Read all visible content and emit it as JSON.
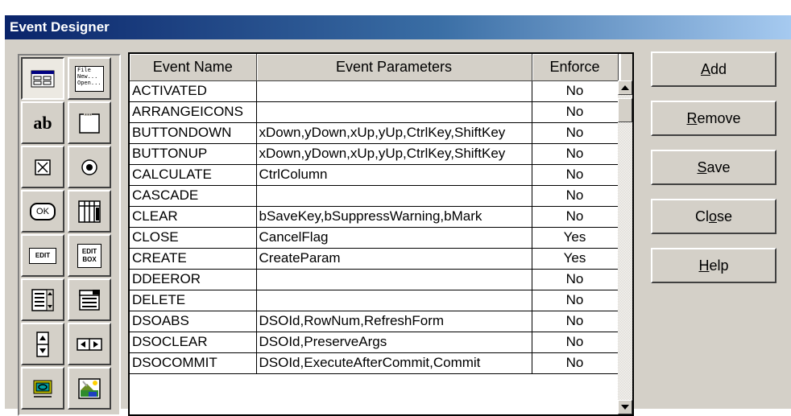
{
  "window": {
    "title": "Event Designer"
  },
  "palette": {
    "tools": [
      {
        "icon": "form-tool-icon",
        "label": ""
      },
      {
        "icon": "menu-tool-icon",
        "label": "File New... Open..."
      },
      {
        "icon": "label-tool-icon",
        "label": "ab"
      },
      {
        "icon": "frame-tool-icon",
        "label": ""
      },
      {
        "icon": "checkbox-tool-icon",
        "label": ""
      },
      {
        "icon": "radio-button-tool-icon",
        "label": ""
      },
      {
        "icon": "command-button-tool-icon",
        "label": "OK"
      },
      {
        "icon": "grid-tool-icon",
        "label": ""
      },
      {
        "icon": "edit-tool-icon",
        "label": "EDIT"
      },
      {
        "icon": "edit-box-tool-icon",
        "label": "EDIT BOX"
      },
      {
        "icon": "list-box-tool-icon",
        "label": ""
      },
      {
        "icon": "combo-box-tool-icon",
        "label": ""
      },
      {
        "icon": "vertical-spin-tool-icon",
        "label": ""
      },
      {
        "icon": "horizontal-spin-tool-icon",
        "label": ""
      },
      {
        "icon": "ole-control-tool-icon",
        "label": ""
      },
      {
        "icon": "image-tool-icon",
        "label": ""
      }
    ]
  },
  "grid": {
    "columns": [
      "Event Name",
      "Event Parameters",
      "Enforce"
    ],
    "rows": [
      [
        "ACTIVATED",
        "",
        "No"
      ],
      [
        "ARRANGEICONS",
        "",
        "No"
      ],
      [
        "BUTTONDOWN",
        "xDown,yDown,xUp,yUp,CtrlKey,ShiftKey",
        "No"
      ],
      [
        "BUTTONUP",
        "xDown,yDown,xUp,yUp,CtrlKey,ShiftKey",
        "No"
      ],
      [
        "CALCULATE",
        "CtrlColumn",
        "No"
      ],
      [
        "CASCADE",
        "",
        "No"
      ],
      [
        "CLEAR",
        "bSaveKey,bSuppressWarning,bMark",
        "No"
      ],
      [
        "CLOSE",
        "CancelFlag",
        "Yes"
      ],
      [
        "CREATE",
        "CreateParam",
        "Yes"
      ],
      [
        "DDEEROR",
        "",
        "No"
      ],
      [
        "DELETE",
        "",
        "No"
      ],
      [
        "DSOABS",
        "DSOId,RowNum,RefreshForm",
        "No"
      ],
      [
        "DSOCLEAR",
        "DSOId,PreserveArgs",
        "No"
      ],
      [
        "DSOCOMMIT",
        "DSOId,ExecuteAfterCommit,Commit",
        "No"
      ]
    ],
    "scrollbar": {
      "up_icon": "scroll-up-icon",
      "down_icon": "scroll-down-icon"
    }
  },
  "buttons": {
    "add": "Add",
    "remove": "Remove",
    "save": "Save",
    "close": "Close",
    "help": "Help"
  },
  "colors": {
    "titlebar_start": "#0a246a",
    "titlebar_end": "#a6caf0",
    "face": "#d4d0c8"
  }
}
